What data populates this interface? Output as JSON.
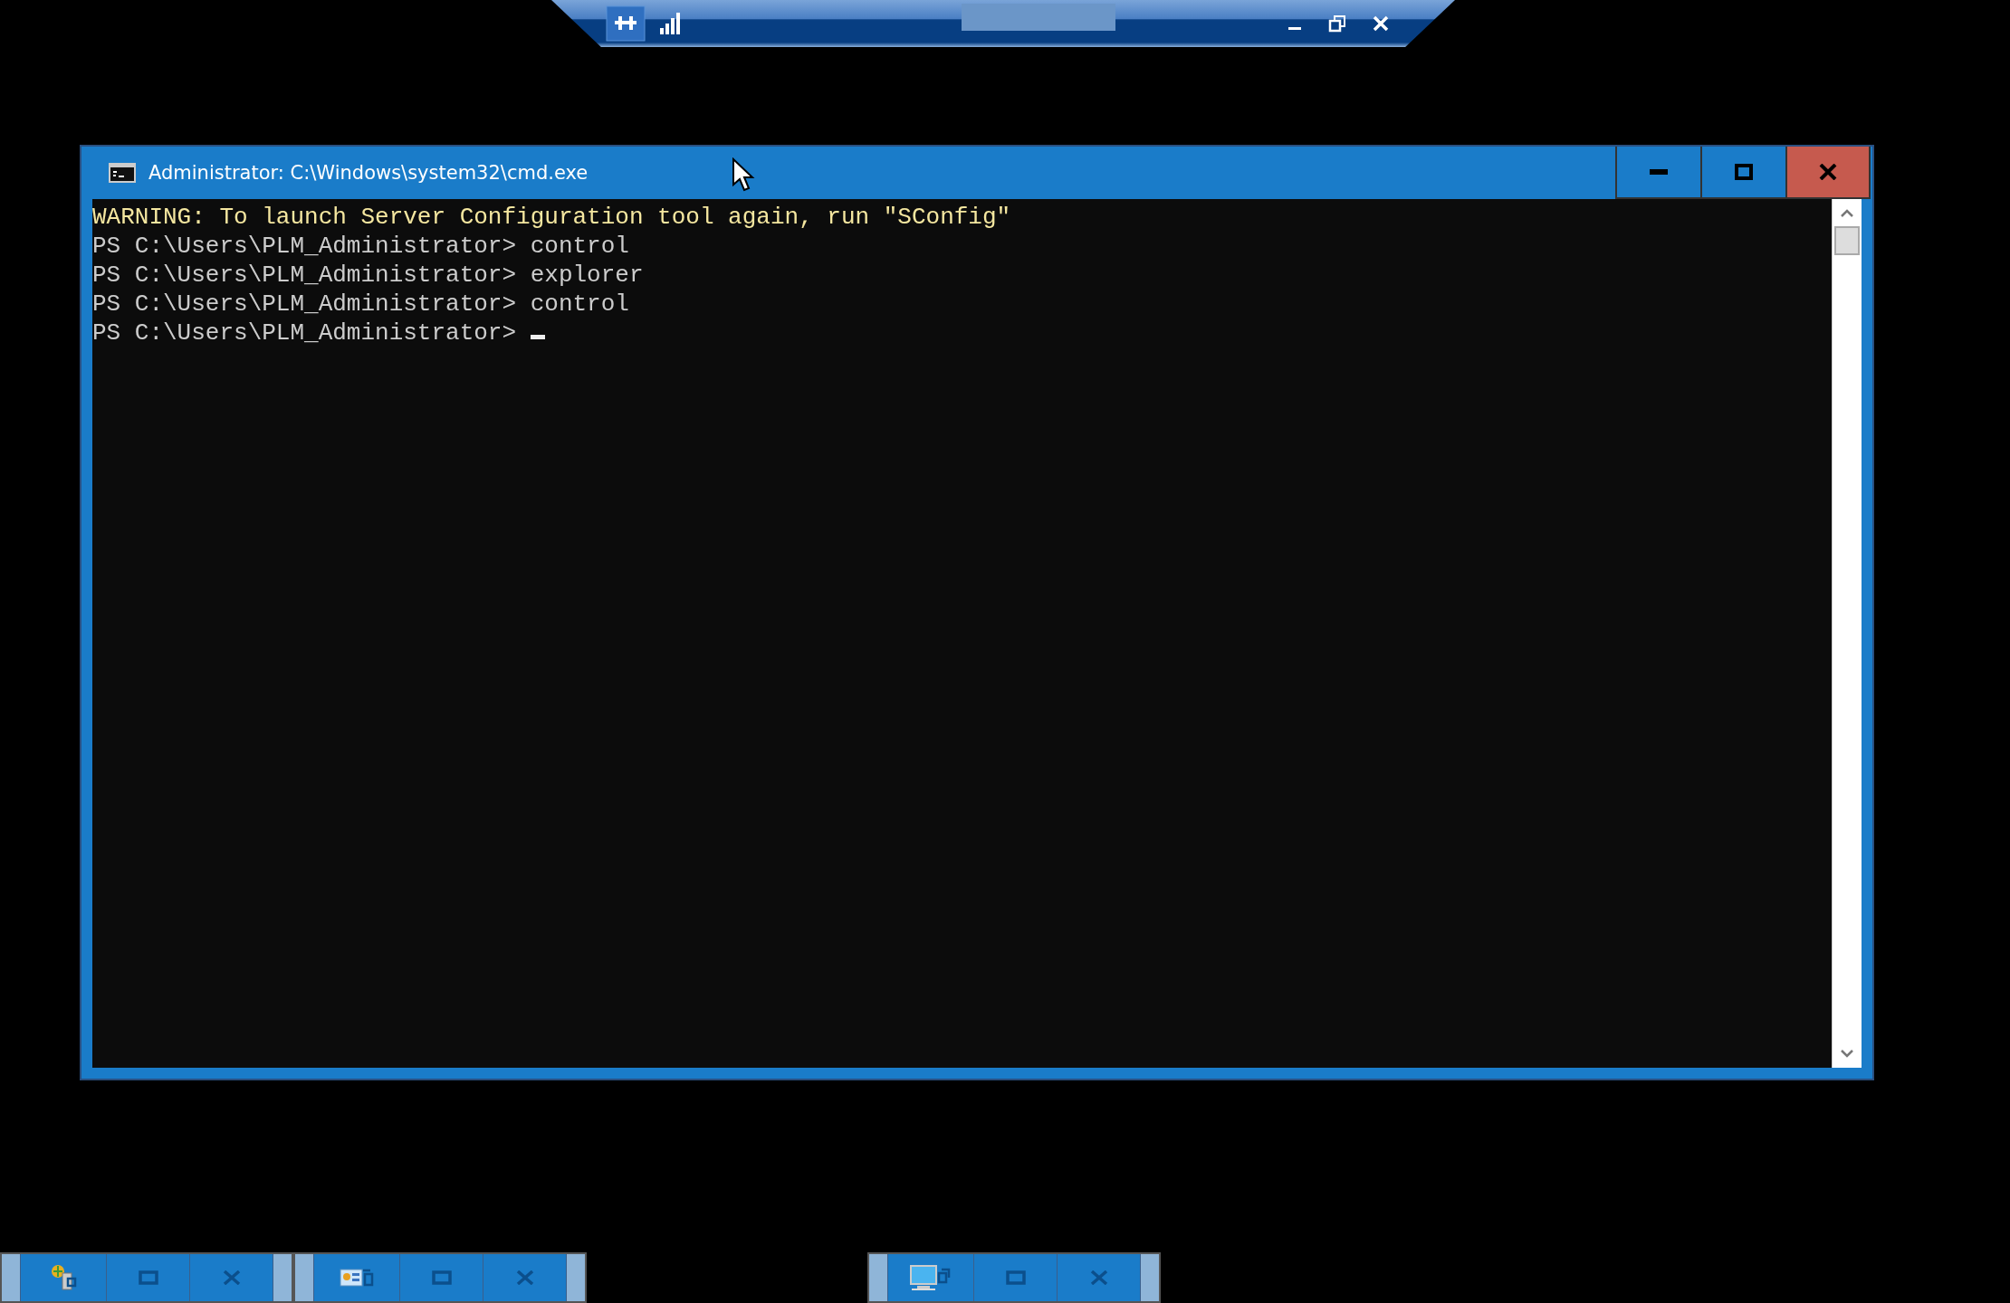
{
  "window": {
    "title": "Administrator: C:\\Windows\\system32\\cmd.exe"
  },
  "console_lines": [
    {
      "kind": "warning",
      "text": "WARNING: To launch Server Configuration tool again, run \"SConfig\""
    },
    {
      "kind": "prompt",
      "text": "PS C:\\Users\\PLM_Administrator> control"
    },
    {
      "kind": "prompt",
      "text": "PS C:\\Users\\PLM_Administrator> explorer"
    },
    {
      "kind": "prompt",
      "text": "PS C:\\Users\\PLM_Administrator> control"
    },
    {
      "kind": "prompt",
      "text": "PS C:\\Users\\PLM_Administrator>"
    }
  ],
  "minimized_windows": [
    {
      "kind": "server"
    },
    {
      "kind": "control-panel"
    },
    {
      "kind": "computer"
    }
  ]
}
